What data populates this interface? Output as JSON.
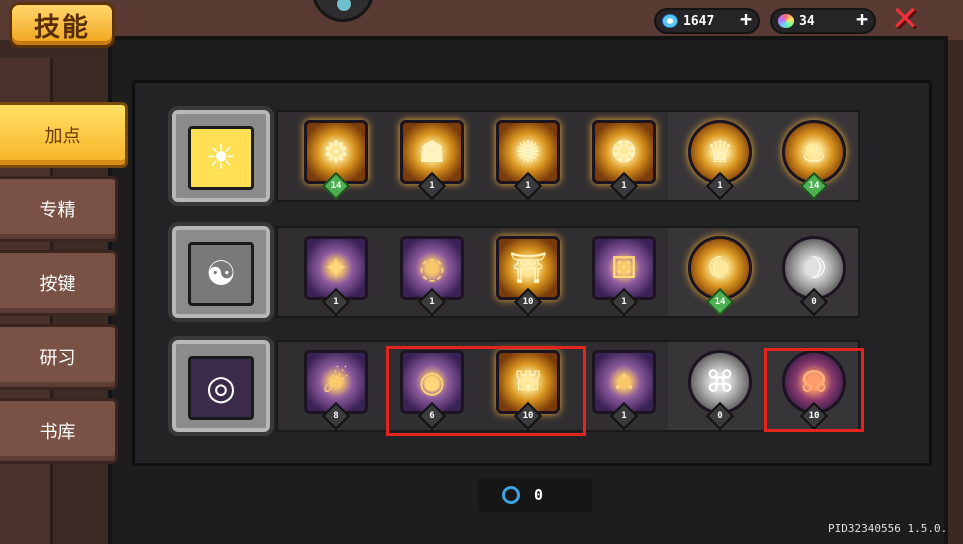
{
  "header": {
    "title": "技能",
    "gems": "1647",
    "crystals": "34",
    "add_label": "+",
    "close_label": "✕"
  },
  "tabs": [
    {
      "label": "加点",
      "active": true
    },
    {
      "label": "专精",
      "active": false
    },
    {
      "label": "按键",
      "active": false
    },
    {
      "label": "研习",
      "active": false
    },
    {
      "label": "书库",
      "active": false
    }
  ],
  "rows": [
    {
      "name": "sun",
      "head_icon": "sun-icon",
      "head_glyph": "☀",
      "skills": [
        {
          "icon": "gears-icon",
          "glyph": "⚙",
          "level": "14",
          "shape": "square",
          "style": "gold",
          "max": true
        },
        {
          "icon": "golem-icon",
          "glyph": "☗",
          "level": "1",
          "shape": "square",
          "style": "gold",
          "max": false
        },
        {
          "icon": "radiant-ring-icon",
          "glyph": "✺",
          "level": "1",
          "shape": "square",
          "style": "gold",
          "max": false
        },
        {
          "icon": "sigil-icon",
          "glyph": "❂",
          "level": "1",
          "shape": "square",
          "style": "gold",
          "max": false
        },
        {
          "icon": "treasure-icon",
          "glyph": "♛",
          "level": "1",
          "shape": "round",
          "style": "gold",
          "max": false
        },
        {
          "icon": "flame-icon",
          "glyph": "♨",
          "level": "14",
          "shape": "round",
          "style": "gold",
          "max": true
        }
      ]
    },
    {
      "name": "wind",
      "head_icon": "yin-yang-icon",
      "head_glyph": "☯",
      "skills": [
        {
          "icon": "slash-icon",
          "glyph": "✦",
          "level": "1",
          "shape": "square",
          "style": "purple",
          "max": false
        },
        {
          "icon": "crescent-ring-icon",
          "glyph": "◌",
          "level": "1",
          "shape": "square",
          "style": "purple",
          "max": false
        },
        {
          "icon": "palace-icon",
          "glyph": "⛩",
          "level": "10",
          "shape": "square",
          "style": "gold",
          "max": false
        },
        {
          "icon": "dice-icon",
          "glyph": "⚄",
          "level": "1",
          "shape": "square",
          "style": "purple",
          "max": false
        },
        {
          "icon": "moon-star-icon",
          "glyph": "☾",
          "level": "14",
          "shape": "round",
          "style": "gold",
          "max": true
        },
        {
          "icon": "locked-moon-icon",
          "glyph": "☽",
          "level": "0",
          "shape": "round",
          "style": "silver",
          "max": false
        }
      ]
    },
    {
      "name": "void",
      "head_icon": "spiral-icon",
      "head_glyph": "◎",
      "skills": [
        {
          "icon": "comet-icon",
          "glyph": "☄",
          "level": "8",
          "shape": "square",
          "style": "purple",
          "max": false
        },
        {
          "icon": "black-hole-icon",
          "glyph": "◉",
          "level": "6",
          "shape": "square",
          "style": "purple",
          "max": false
        },
        {
          "icon": "portal-gate-icon",
          "glyph": "⛫",
          "level": "10",
          "shape": "square",
          "style": "gold",
          "max": false
        },
        {
          "icon": "orbs-icon",
          "glyph": "∴",
          "level": "1",
          "shape": "square",
          "style": "purple",
          "max": false
        },
        {
          "icon": "locked-rune-icon",
          "glyph": "⌘",
          "level": "0",
          "shape": "round",
          "style": "silver",
          "max": false
        },
        {
          "icon": "octopus-icon",
          "glyph": "☊",
          "level": "10",
          "shape": "round",
          "style": "dark",
          "max": false
        }
      ]
    }
  ],
  "footer": {
    "skill_points": "0",
    "version": "PID32340556 1.5.0."
  },
  "colors": {
    "accent_gold": "#f5b324",
    "highlight_red": "#e3251d",
    "max_level_green": "#4caf50"
  }
}
